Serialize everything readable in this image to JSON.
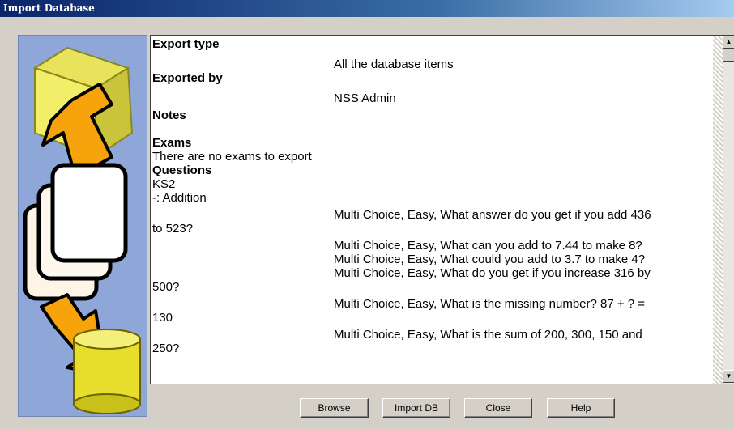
{
  "window": {
    "title": "Import Database"
  },
  "content": {
    "export_type_label": "Export type",
    "export_type_value": "All the database items",
    "exported_by_label": "Exported by",
    "exported_by_value": "NSS Admin",
    "notes_label": "Notes",
    "exams_label": "Exams",
    "exams_value": "There are no exams to export",
    "questions_label": "Questions",
    "group": "KS2",
    "subgroup": "-: Addition",
    "questions": [
      {
        "line1": "Multi Choice, Easy, What answer do you get if you add 436",
        "line2": "to 523?"
      },
      {
        "line1": "Multi Choice, Easy, What can you add to 7.44 to make 8?",
        "line2": ""
      },
      {
        "line1": "Multi Choice, Easy, What could you add to 3.7 to make 4?",
        "line2": ""
      },
      {
        "line1": "Multi Choice, Easy, What do you get if you increase 316 by",
        "line2": "500?"
      },
      {
        "line1": "Multi Choice, Easy, What is the missing number? 87 +  ? =",
        "line2": "130"
      },
      {
        "line1": "Multi Choice, Easy, What is the sum of 200, 300, 150 and",
        "line2": "250?"
      }
    ]
  },
  "scrollbar": {
    "up_icon": "up-arrow-icon",
    "down_icon": "down-arrow-icon"
  },
  "buttons": {
    "browse": "Browse",
    "import_db": "Import DB",
    "close": "Close",
    "help": "Help"
  },
  "colors": {
    "titlebar_start": "#0a246a",
    "titlebar_end": "#a6caf0",
    "dialog_bg": "#d4d0c8",
    "side_art_bg": "#8fa7d8"
  }
}
